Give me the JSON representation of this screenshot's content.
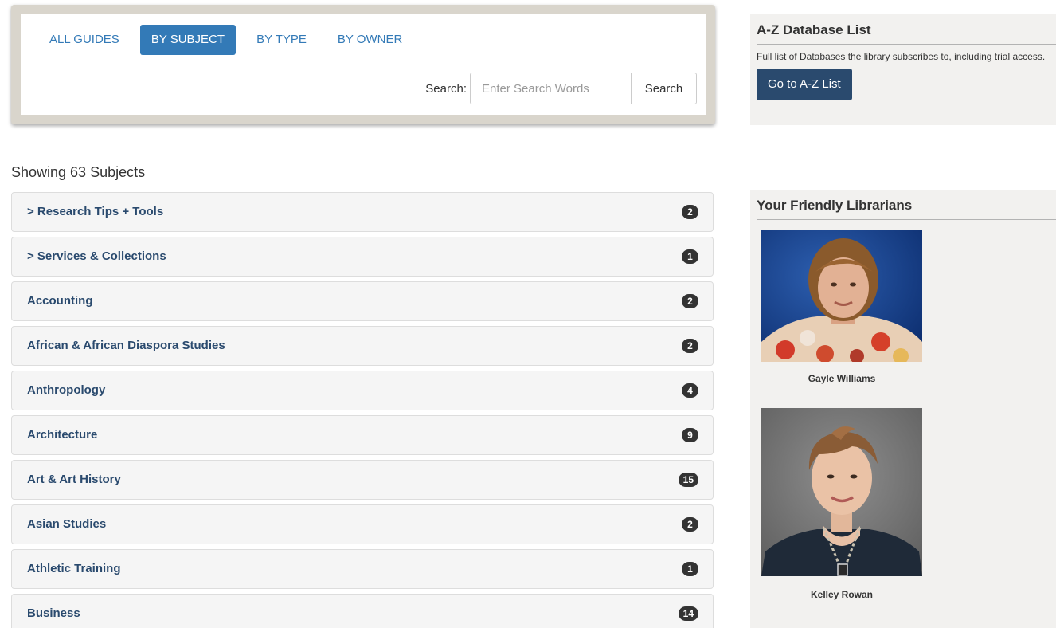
{
  "guides_nav": {
    "tabs": [
      {
        "label": "ALL GUIDES",
        "active": false
      },
      {
        "label": "BY SUBJECT",
        "active": true
      },
      {
        "label": "BY TYPE",
        "active": false
      },
      {
        "label": "BY OWNER",
        "active": false
      }
    ],
    "search": {
      "label": "Search:",
      "placeholder": "Enter Search Words",
      "value": "",
      "button_label": "Search"
    }
  },
  "subjects": {
    "showing_text": "Showing 63 Subjects",
    "items": [
      {
        "name": "> Research Tips + Tools",
        "count": "2"
      },
      {
        "name": "> Services & Collections",
        "count": "1"
      },
      {
        "name": "Accounting",
        "count": "2"
      },
      {
        "name": "African & African Diaspora Studies",
        "count": "2"
      },
      {
        "name": "Anthropology",
        "count": "4"
      },
      {
        "name": "Architecture",
        "count": "9"
      },
      {
        "name": "Art & Art History",
        "count": "15"
      },
      {
        "name": "Asian Studies",
        "count": "2"
      },
      {
        "name": "Athletic Training",
        "count": "1"
      },
      {
        "name": "Business",
        "count": "14"
      }
    ]
  },
  "az_database": {
    "title": "A-Z Database List",
    "description": "Full list of Databases the library subscribes to, including trial access.",
    "button_label": "Go to A-Z List"
  },
  "librarians": {
    "title": "Your Friendly Librarians",
    "people": [
      {
        "name": "Gayle Williams"
      },
      {
        "name": "Kelley Rowan"
      }
    ]
  },
  "colors": {
    "link_blue": "#337ab7",
    "navy_button": "#2a4a6e",
    "badge": "#333333",
    "panel_frame": "#d9d5cc",
    "sidebar_bg": "#f2f1ef"
  }
}
